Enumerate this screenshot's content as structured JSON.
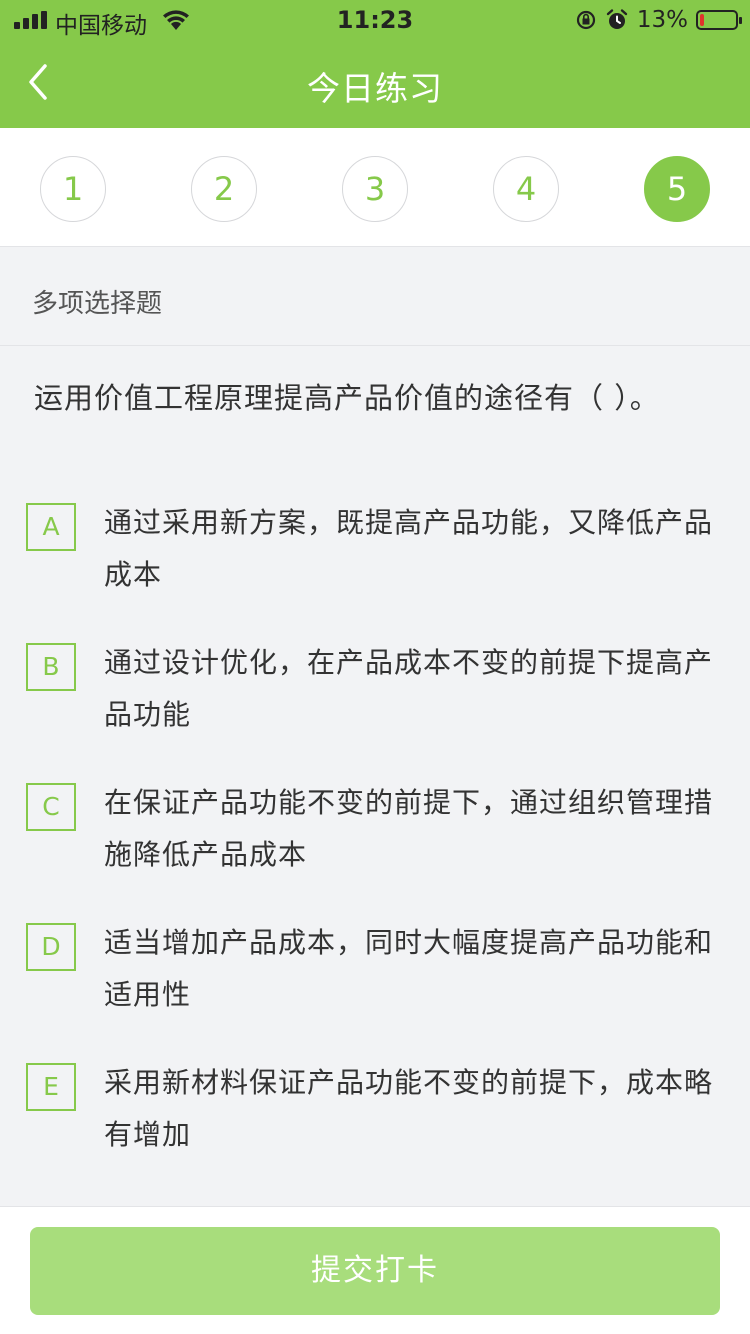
{
  "status_bar": {
    "carrier": "中国移动",
    "time": "11:23",
    "battery_text": "13%",
    "battery_level": 0.13,
    "icons": [
      "signal-icon",
      "wifi-icon",
      "orientation-lock-icon",
      "alarm-icon",
      "battery-icon"
    ]
  },
  "header": {
    "title": "今日练习",
    "back_icon": "chevron-left-icon"
  },
  "tabs": [
    {
      "label": "1",
      "active": false
    },
    {
      "label": "2",
      "active": false
    },
    {
      "label": "3",
      "active": false
    },
    {
      "label": "4",
      "active": false
    },
    {
      "label": "5",
      "active": true
    }
  ],
  "question": {
    "type": "多项选择题",
    "text": "运用价值工程原理提高产品价值的途径有（   ）。",
    "options": [
      {
        "letter": "A",
        "text": "通过采用新方案，既提高产品功能，又降低产品成本"
      },
      {
        "letter": "B",
        "text": "通过设计优化，在产品成本不变的前提下提高产品功能"
      },
      {
        "letter": "C",
        "text": "在保证产品功能不变的前提下，通过组织管理措施降低产品成本"
      },
      {
        "letter": "D",
        "text": "适当增加产品成本，同时大幅度提高产品功能和适用性"
      },
      {
        "letter": "E",
        "text": "采用新材料保证产品功能不变的前提下，成本略有增加"
      }
    ]
  },
  "footer": {
    "submit_label": "提交打卡"
  },
  "colors": {
    "accent": "#86c94a",
    "submit_disabled": "#a8dd7c",
    "background": "#f2f3f5"
  }
}
